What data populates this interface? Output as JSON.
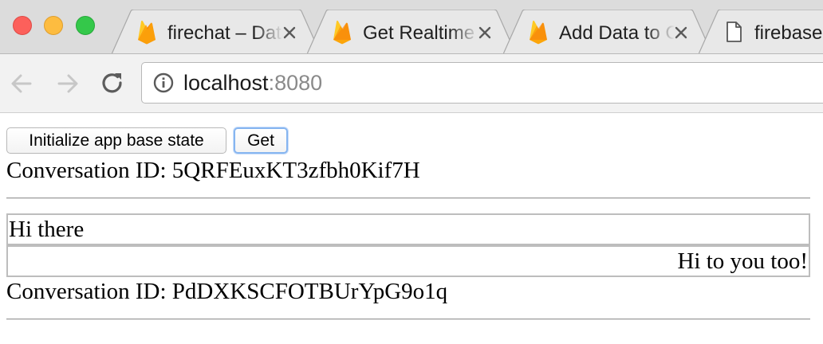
{
  "browser": {
    "tabs": [
      {
        "title": "firechat – Data",
        "icon": "firebase-flame-icon",
        "active": false
      },
      {
        "title": "Get Realtime Updates",
        "icon": "firebase-flame-icon",
        "active": false
      },
      {
        "title": "Add Data to Cloud",
        "icon": "firebase-flame-icon",
        "active": false
      },
      {
        "title": "firebase",
        "icon": "document-icon",
        "active": false
      }
    ],
    "address": {
      "host": "localhost",
      "port": ":8080"
    },
    "colors": {
      "traffic_close": "#fc605b",
      "traffic_minimize": "#fdbc40",
      "traffic_zoom": "#34c84a",
      "focus_ring": "#86b5f0"
    }
  },
  "page": {
    "buttons": {
      "init_label": "Initialize app base state",
      "get_label": "Get"
    },
    "conversations": [
      {
        "id_text": "Conversation ID: 5QRFEuxKT3zfbh0Kif7H",
        "messages": [
          {
            "text": "Hi there",
            "align": "left"
          },
          {
            "text": "Hi to you too!",
            "align": "right"
          }
        ]
      },
      {
        "id_text": "Conversation ID: PdDXKSCFOTBUrYpG9o1q",
        "messages": []
      }
    ]
  }
}
